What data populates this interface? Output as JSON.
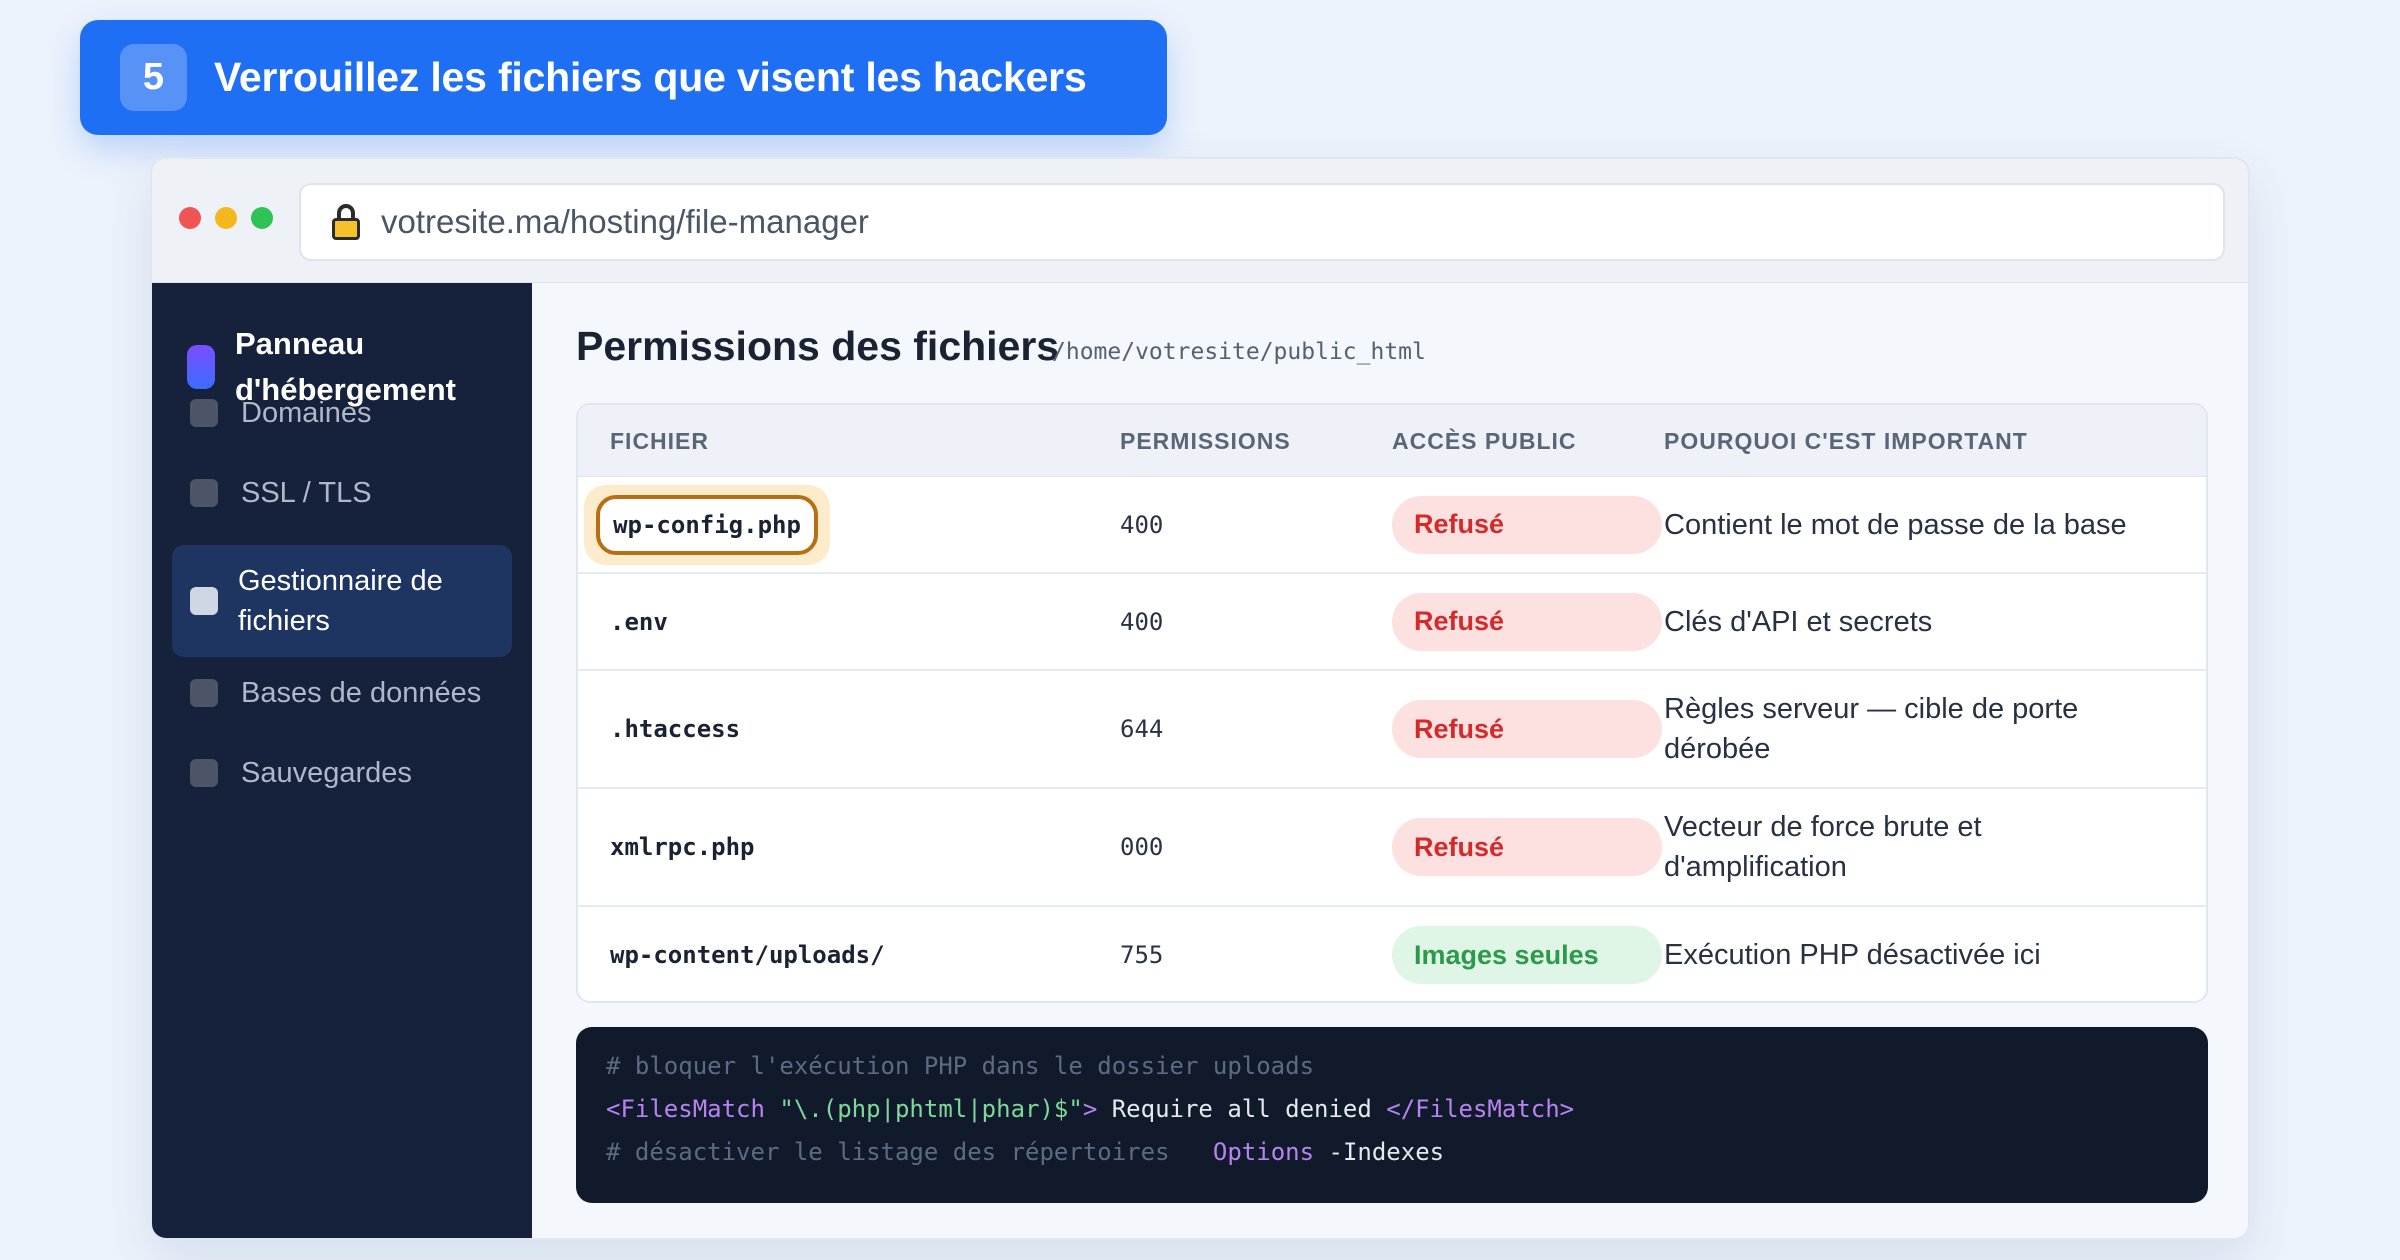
{
  "banner": {
    "step": "5",
    "title": "Verrouillez les fichiers que visent les hackers"
  },
  "browser": {
    "url": "votresite.ma/hosting/file-manager",
    "lock_icon": "lock-icon"
  },
  "sidebar": {
    "brand": "Panneau d'hébergement",
    "items": [
      {
        "label": "Domaines",
        "active": false
      },
      {
        "label": "SSL / TLS",
        "active": false
      },
      {
        "label": "Gestionnaire de fichiers",
        "active": true
      },
      {
        "label": "Bases de données",
        "active": false
      },
      {
        "label": "Sauvegardes",
        "active": false
      }
    ]
  },
  "main": {
    "title": "Permissions des fichiers",
    "path": "/home/votresite/public_html",
    "table": {
      "headers": [
        "FICHIER",
        "PERMISSIONS",
        "ACCÈS PUBLIC",
        "POURQUOI C'EST IMPORTANT"
      ],
      "rows": [
        {
          "file": "wp-config.php",
          "perm": "400",
          "access": "Refusé",
          "reason": "Contient le mot de passe de la base",
          "highlighted": true
        },
        {
          "file": ".env",
          "perm": "400",
          "access": "Refusé",
          "reason": "Clés d'API et secrets"
        },
        {
          "file": ".htaccess",
          "perm": "644",
          "access": "Refusé",
          "reason": "Règles serveur — cible de porte dérobée"
        },
        {
          "file": "xmlrpc.php",
          "perm": "000",
          "access": "Refusé",
          "reason": "Vecteur de force brute et d'amplification"
        },
        {
          "file": "wp-content/uploads/",
          "perm": "755",
          "access": "Images seules",
          "reason": "Exécution PHP désactivée ici"
        }
      ]
    },
    "code": {
      "line1_comment": "# bloquer l'exécution PHP dans le dossier uploads",
      "line2_open": "<FilesMatch ",
      "line2_str": "\"\\.(php|phtml|phar)$\"",
      "line2_close_bracket": ">",
      "line2_body": " Require all denied ",
      "line2_end": "</FilesMatch>",
      "line3_comment": "# désactiver le listage des répertoires",
      "line3_kw": "Options",
      "line3_val": " -Indexes"
    }
  },
  "colors": {
    "accent": "#1f6ff5",
    "sidebar": "#16223b",
    "deny": "#d42a2a",
    "ok": "#2c9a4a",
    "highlight": "#b86e12"
  }
}
